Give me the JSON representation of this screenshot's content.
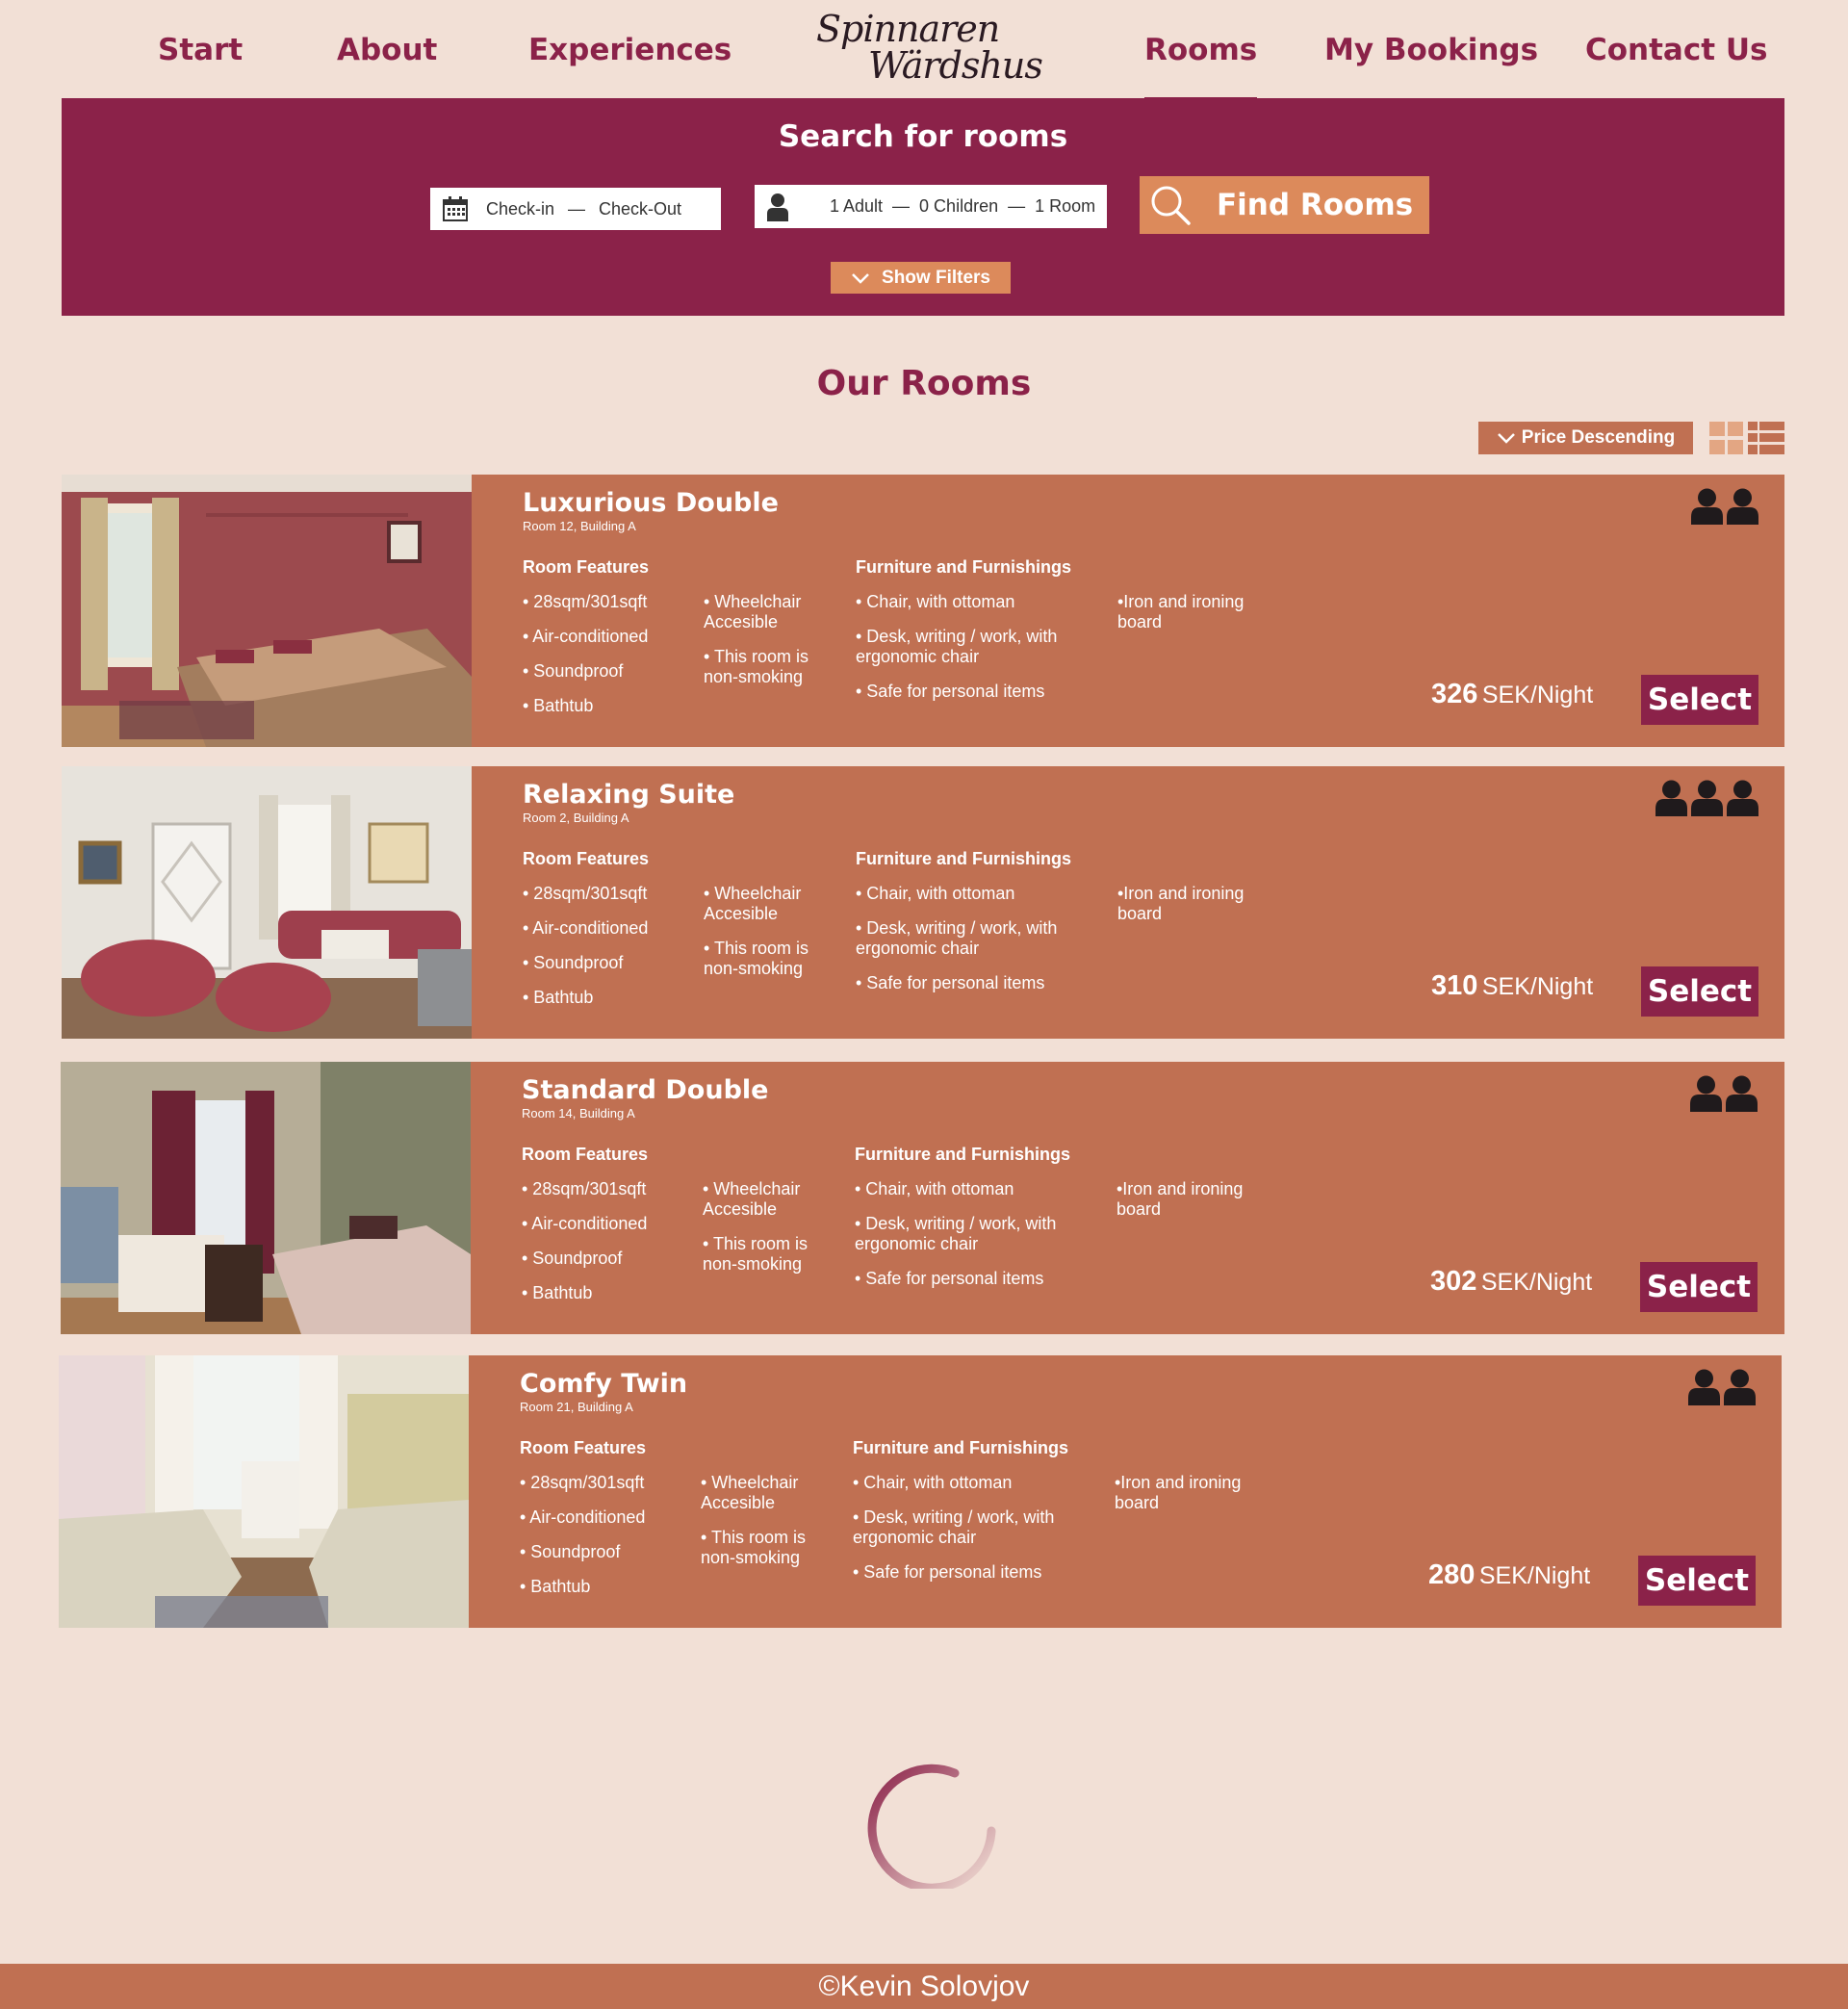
{
  "nav": {
    "items": [
      {
        "label": "Start"
      },
      {
        "label": "About"
      },
      {
        "label": "Experiences"
      },
      {
        "label": "Rooms",
        "active": true
      },
      {
        "label": "My Bookings"
      },
      {
        "label": "Contact Us"
      }
    ],
    "logo_line1": "Spinnaren",
    "logo_line2": "Wärdshus"
  },
  "search": {
    "title": "Search for rooms",
    "checkin": "Check-in",
    "checkout": "Check-Out",
    "adults": "1 Adult",
    "children": "0 Children",
    "rooms": "1 Room",
    "find_label": "Find Rooms",
    "filters_label": "Show Filters"
  },
  "rooms_section": {
    "title": "Our Rooms",
    "sort_label": "Price Descending"
  },
  "labels": {
    "features_heading": "Room Features",
    "furnishings_heading": "Furniture and Furnishings",
    "unit": "SEK/Night",
    "select": "Select"
  },
  "rooms": [
    {
      "name": "Luxurious Double",
      "location": "Room 12, Building A",
      "price": "326",
      "guests": 2,
      "features": [
        "• 28sqm/301sqft",
        "• Air-conditioned",
        "• Soundproof",
        "• Bathtub"
      ],
      "features2": [
        "• Wheelchair\nAccesible",
        "• This room is\nnon-smoking"
      ],
      "furnishings": [
        "• Chair, with ottoman",
        "• Desk, writing / work, with\nergonomic chair",
        "• Safe for personal items"
      ],
      "furnishings2": [
        "•Iron and ironing\nboard"
      ]
    },
    {
      "name": "Relaxing Suite",
      "location": "Room 2, Building A",
      "price": "310",
      "guests": 3,
      "features": [
        "• 28sqm/301sqft",
        "• Air-conditioned",
        "• Soundproof",
        "• Bathtub"
      ],
      "features2": [
        "• Wheelchair\nAccesible",
        "• This room is\nnon-smoking"
      ],
      "furnishings": [
        "• Chair, with ottoman",
        "• Desk, writing / work, with\nergonomic chair",
        "• Safe for personal items"
      ],
      "furnishings2": [
        "•Iron and ironing\nboard"
      ]
    },
    {
      "name": "Standard Double",
      "location": "Room 14, Building A",
      "price": "302",
      "guests": 2,
      "features": [
        "• 28sqm/301sqft",
        "• Air-conditioned",
        "• Soundproof",
        "• Bathtub"
      ],
      "features2": [
        "• Wheelchair\nAccesible",
        "• This room is\nnon-smoking"
      ],
      "furnishings": [
        "• Chair, with ottoman",
        "• Desk, writing / work, with\nergonomic chair",
        "• Safe for personal items"
      ],
      "furnishings2": [
        "•Iron and ironing\nboard"
      ]
    },
    {
      "name": "Comfy Twin",
      "location": "Room 21, Building A",
      "price": "280",
      "guests": 2,
      "features": [
        "• 28sqm/301sqft",
        "• Air-conditioned",
        "• Soundproof",
        "• Bathtub"
      ],
      "features2": [
        "• Wheelchair\nAccesible",
        "• This room is\nnon-smoking"
      ],
      "furnishings": [
        "• Chair, with ottoman",
        "• Desk, writing / work, with\nergonomic chair",
        "• Safe for personal items"
      ],
      "furnishings2": [
        "•Iron and ironing\nboard"
      ]
    }
  ],
  "footer": {
    "text": "©Kevin Solovjov"
  },
  "colors": {
    "background": "#f2e0d6",
    "primary": "#8b2249",
    "card": "#c07052",
    "accent": "#dc8a5b"
  },
  "icons": {
    "calendar": "calendar-icon",
    "person": "person-icon",
    "search": "search-icon",
    "chevron": "chevron-down-icon",
    "grid": "grid-view-icon",
    "list": "list-view-icon",
    "guest": "guest-icon",
    "spinner": "loading-spinner"
  }
}
